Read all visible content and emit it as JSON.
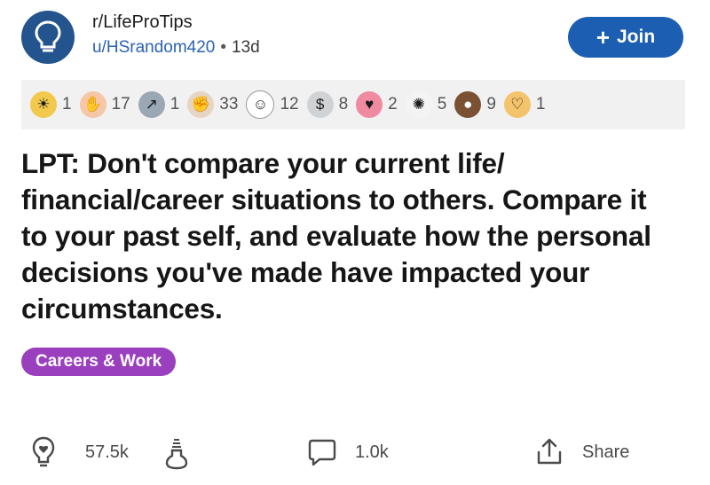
{
  "post": {
    "subreddit": "r/LifeProTips",
    "author": "u/HSrandom420",
    "separator": "•",
    "age": "13d",
    "join_label": "Join",
    "title": "LPT: Don't compare your current life/ financial/career situations to others. Compare it to your past self, and evaluate how the personal decisions you've made have impacted your circumstances.",
    "flair": "Careers & Work",
    "score": "57.5k",
    "comments": "1.0k",
    "share_label": "Share"
  },
  "awards": [
    {
      "icon": "gold-award-icon",
      "count": "1",
      "color": "#f2c94c"
    },
    {
      "icon": "helpful-hand-award-icon",
      "count": "17",
      "color": "#f6c7a6"
    },
    {
      "icon": "stonks-rising-award-icon",
      "count": "1",
      "color": "#9aa7b5"
    },
    {
      "icon": "hugz-award-icon",
      "count": "33",
      "color": "#e6d5c2"
    },
    {
      "icon": "wholesome-award-icon",
      "count": "12",
      "color": "#ffffff"
    },
    {
      "icon": "money-jar-award-icon",
      "count": "8",
      "color": "#cfd3d6"
    },
    {
      "icon": "heart-eyes-award-icon",
      "count": "2",
      "color": "#ef8aa0"
    },
    {
      "icon": "dance-award-icon",
      "count": "5",
      "color": "#f4f4f4"
    },
    {
      "icon": "bear-award-icon",
      "count": "9",
      "color": "#7a5233"
    },
    {
      "icon": "heart-face-award-icon",
      "count": "1",
      "color": "#f3c46b"
    }
  ],
  "colors": {
    "subreddit_icon_bg": "#24548e",
    "join_bg": "#1c5fb2",
    "flair_bg": "#9a3fbd",
    "author_link": "#2a62b0"
  }
}
